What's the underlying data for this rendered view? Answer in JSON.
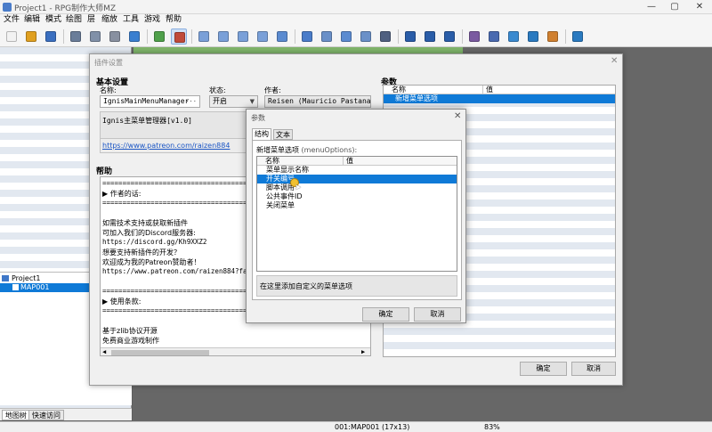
{
  "window": {
    "title": "Project1 - RPG制作大师MZ",
    "minimize": "—",
    "maximize": "▢",
    "close": "✕"
  },
  "menubar": [
    "文件",
    "编辑",
    "模式",
    "绘图",
    "层",
    "缩放",
    "工具",
    "游戏",
    "帮助"
  ],
  "tree": {
    "project": "Project1",
    "map": "MAP001"
  },
  "bottom_tabs": [
    "地图树",
    "快速访问"
  ],
  "statusbar": {
    "map": "001:MAP001 (17x13)",
    "zoom": "83%"
  },
  "plugin_window": {
    "title": "插件设置",
    "basic_header": "基本设置",
    "name_label": "名称:",
    "name_value": "IgnisMainMenuManager",
    "status_label": "状态:",
    "status_value": "开启",
    "author_label": "作者:",
    "author_value": "Reisen (Mauricio Pastana)",
    "description": "Ignis主菜单管理器[v1.0]",
    "link": "https://www.patreon.com/raizen884",
    "help_header": "帮助",
    "help_lines": [
      "================================================",
      "▶ 作者的话:",
      "================================================",
      "",
      "如需技术支持或获取新插件",
      "可加入我们的Discord服务器:",
      "https://discord.gg/Kh9XXZ2",
      "想要支持新插件的开发？",
      "欢迎成为我的Patreon赞助者！",
      "https://www.patreon.com/raizen884?fan_landi",
      "",
      "================================================",
      "▶ 使用条款:",
      "================================================",
      "",
      "基于zlib协议开源",
      "免费商业游戏制作"
    ],
    "params_header": "参数",
    "col_name": "名称",
    "col_value": "值",
    "param_rows": [
      "新增菜单选项"
    ],
    "ok": "确定",
    "cancel": "取消"
  },
  "param_dialog": {
    "title": "参数",
    "tab_structure": "结构",
    "tab_text": "文本",
    "field_label": "新增菜单选项",
    "field_key": "(menuOptions):",
    "col_name": "名称",
    "col_value": "值",
    "rows": [
      "菜单显示名称",
      "开关编号",
      "脚本调用",
      "公共事件ID",
      "关闭菜单"
    ],
    "selected_index": 1,
    "description": "在这里添加自定义的菜单选项",
    "ok": "确定",
    "cancel": "取消"
  },
  "toolbar_icons": [
    "new-project-icon",
    "open-project-icon",
    "save-project-icon",
    "cut-icon",
    "copy-icon",
    "paste-icon",
    "undo-icon",
    "map-mode-icon",
    "event-mode-icon",
    "layer-1-icon",
    "layer-2-icon",
    "layer-3-icon",
    "layer-4-icon",
    "layer-auto-icon",
    "pencil-icon",
    "rectangle-icon",
    "ellipse-icon",
    "flood-fill-icon",
    "shadow-pen-icon",
    "zoom-in-icon",
    "zoom-out-icon",
    "zoom-actual-icon",
    "database-icon",
    "plugin-manager-icon",
    "sound-test-icon",
    "event-searcher-icon",
    "character-generator-icon",
    "playtest-icon"
  ]
}
